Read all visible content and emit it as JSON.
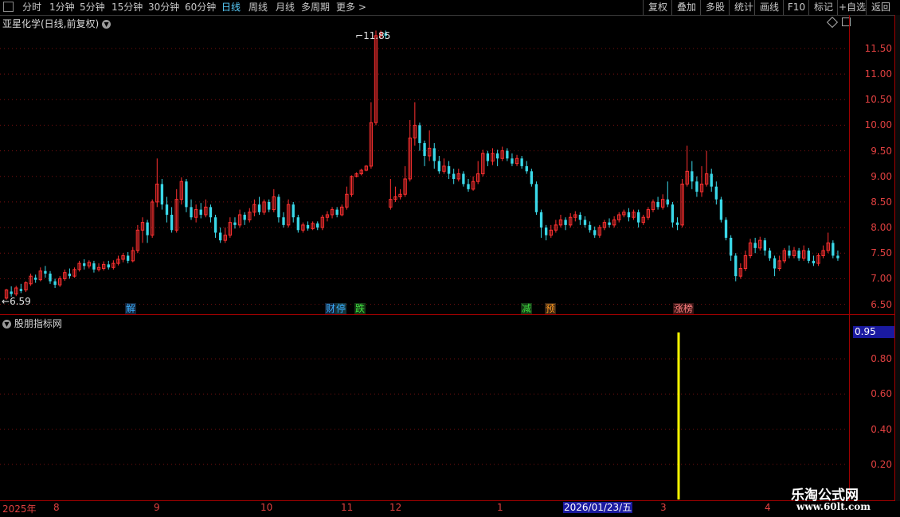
{
  "toolbar": {
    "periods": [
      "分时",
      "1分钟",
      "5分钟",
      "15分钟",
      "30分钟",
      "60分钟",
      "日线",
      "周线",
      "月线",
      "多周期",
      "更多 >"
    ],
    "active_period": "日线",
    "right_buttons": [
      "复权",
      "叠加",
      "多股",
      "统计",
      "画线",
      "F10",
      "标记",
      "+自选",
      "返回"
    ]
  },
  "main_chart": {
    "title": "亚星化学(日线,前复权)",
    "high_label": "11.85",
    "low_label": "6.59",
    "y_ticks": [
      "11.50",
      "11.00",
      "10.50",
      "10.00",
      "9.50",
      "9.00",
      "8.50",
      "8.00",
      "7.50",
      "7.00",
      "6.50"
    ],
    "markers": [
      {
        "text": "解",
        "color": "#3ab0ff",
        "bg": "#1a1a3a"
      },
      {
        "text": "财",
        "color": "#3ab0ff",
        "bg": "#1a1a3a"
      },
      {
        "text": "停",
        "color": "#3ab0ff",
        "bg": "#1a3a3a"
      },
      {
        "text": "跌",
        "color": "#40e040",
        "bg": "#1a3a1a"
      },
      {
        "text": "减",
        "color": "#40e040",
        "bg": "#1a3a1a"
      },
      {
        "text": "预",
        "color": "#ff8c00",
        "bg": "#3a2a1a"
      },
      {
        "text": "涨榜",
        "color": "#ff8080",
        "bg": "#3a1a1a"
      }
    ],
    "colors": {
      "up": "#ff3030",
      "down": "#3ad8e8",
      "grid": "#7a1010",
      "axis": "#a00000"
    }
  },
  "indicator_panel": {
    "title": "股朋指标网",
    "value": "0.95",
    "y_ticks": [
      "0.80",
      "0.60",
      "0.40",
      "0.20"
    ],
    "bar_color": "#ffff00"
  },
  "x_axis": {
    "ticks": [
      "2025年",
      "8",
      "9",
      "10",
      "11",
      "12",
      "1",
      "3",
      "4"
    ],
    "cursor_date": "2026/01/23/五"
  },
  "watermark": {
    "line1": "乐淘公式网",
    "line2": "www.60lt.com"
  },
  "chart_data": {
    "type": "candlestick",
    "title": "亚星化学(日线,前复权)",
    "ylim": [
      6.4,
      11.95
    ],
    "candles": [
      [
        6.62,
        6.78,
        6.59,
        6.8
      ],
      [
        6.75,
        6.7,
        6.65,
        6.85
      ],
      [
        6.7,
        6.82,
        6.66,
        6.86
      ],
      [
        6.8,
        6.76,
        6.72,
        6.9
      ],
      [
        6.78,
        6.92,
        6.74,
        6.95
      ],
      [
        6.9,
        7.05,
        6.86,
        7.1
      ],
      [
        7.02,
        6.98,
        6.92,
        7.08
      ],
      [
        6.98,
        7.15,
        6.95,
        7.22
      ],
      [
        7.15,
        7.1,
        7.02,
        7.25
      ],
      [
        7.1,
        6.95,
        6.9,
        7.15
      ],
      [
        6.95,
        6.88,
        6.82,
        7.0
      ],
      [
        6.88,
        7.0,
        6.84,
        7.05
      ],
      [
        7.0,
        7.12,
        6.96,
        7.18
      ],
      [
        7.1,
        7.05,
        7.0,
        7.2
      ],
      [
        7.05,
        7.18,
        7.02,
        7.22
      ],
      [
        7.18,
        7.3,
        7.14,
        7.35
      ],
      [
        7.3,
        7.25,
        7.18,
        7.38
      ],
      [
        7.25,
        7.32,
        7.2,
        7.36
      ],
      [
        7.3,
        7.18,
        7.12,
        7.35
      ],
      [
        7.18,
        7.22,
        7.14,
        7.3
      ],
      [
        7.2,
        7.28,
        7.16,
        7.34
      ],
      [
        7.28,
        7.22,
        7.18,
        7.35
      ],
      [
        7.22,
        7.3,
        7.18,
        7.36
      ],
      [
        7.3,
        7.38,
        7.26,
        7.45
      ],
      [
        7.38,
        7.45,
        7.32,
        7.5
      ],
      [
        7.45,
        7.35,
        7.3,
        7.52
      ],
      [
        7.35,
        7.55,
        7.32,
        7.62
      ],
      [
        7.55,
        7.95,
        7.5,
        8.05
      ],
      [
        7.95,
        8.1,
        7.7,
        8.2
      ],
      [
        8.1,
        7.85,
        7.7,
        8.15
      ],
      [
        7.85,
        8.5,
        7.8,
        8.55
      ],
      [
        8.5,
        8.85,
        8.4,
        9.35
      ],
      [
        8.85,
        8.45,
        8.35,
        8.95
      ],
      [
        8.45,
        8.25,
        8.1,
        8.6
      ],
      [
        8.25,
        7.95,
        7.9,
        8.4
      ],
      [
        7.95,
        8.55,
        7.9,
        8.75
      ],
      [
        8.55,
        8.9,
        8.45,
        8.98
      ],
      [
        8.9,
        8.4,
        8.3,
        8.95
      ],
      [
        8.4,
        8.2,
        8.15,
        8.55
      ],
      [
        8.2,
        8.35,
        8.1,
        8.45
      ],
      [
        8.35,
        8.25,
        8.18,
        8.48
      ],
      [
        8.25,
        8.4,
        8.2,
        8.55
      ],
      [
        8.4,
        8.2,
        8.1,
        8.45
      ],
      [
        8.2,
        7.9,
        7.8,
        8.25
      ],
      [
        7.9,
        7.75,
        7.7,
        8.0
      ],
      [
        7.75,
        7.85,
        7.7,
        8.0
      ],
      [
        7.85,
        8.1,
        7.8,
        8.2
      ],
      [
        8.1,
        8.05,
        7.98,
        8.2
      ],
      [
        8.05,
        8.25,
        8.0,
        8.35
      ],
      [
        8.25,
        8.15,
        8.05,
        8.3
      ],
      [
        8.15,
        8.3,
        8.1,
        8.38
      ],
      [
        8.3,
        8.45,
        8.22,
        8.55
      ],
      [
        8.45,
        8.3,
        8.25,
        8.6
      ],
      [
        8.3,
        8.5,
        8.25,
        8.55
      ],
      [
        8.5,
        8.35,
        8.3,
        8.55
      ],
      [
        8.35,
        8.6,
        8.3,
        8.75
      ],
      [
        8.6,
        8.2,
        8.1,
        8.65
      ],
      [
        8.2,
        8.05,
        8.0,
        8.3
      ],
      [
        8.05,
        8.45,
        8.0,
        8.55
      ],
      [
        8.45,
        8.2,
        8.1,
        8.5
      ],
      [
        8.2,
        7.95,
        7.9,
        8.25
      ],
      [
        7.95,
        8.05,
        7.9,
        8.1
      ],
      [
        8.05,
        7.98,
        7.94,
        8.12
      ],
      [
        7.98,
        8.08,
        7.95,
        8.12
      ],
      [
        8.08,
        8.0,
        7.95,
        8.12
      ],
      [
        8.0,
        8.2,
        7.95,
        8.25
      ],
      [
        8.2,
        8.25,
        8.12,
        8.32
      ],
      [
        8.25,
        8.35,
        8.18,
        8.4
      ],
      [
        8.35,
        8.25,
        8.2,
        8.4
      ],
      [
        8.25,
        8.4,
        8.22,
        8.45
      ],
      [
        8.4,
        8.65,
        8.35,
        8.8
      ],
      [
        8.65,
        9.0,
        8.6,
        9.02
      ],
      [
        9.0,
        9.05,
        8.98,
        9.08
      ],
      [
        9.05,
        9.12,
        9.02,
        9.15
      ],
      [
        9.12,
        9.2,
        9.1,
        9.22
      ],
      [
        9.2,
        10.05,
        9.15,
        10.45
      ],
      [
        10.05,
        11.75,
        10.0,
        11.85
      ],
      [
        11.75,
        11.8,
        11.7,
        11.85
      ],
      [
        11.8,
        11.75,
        11.7,
        11.85
      ],
      [
        8.4,
        8.55,
        8.35,
        8.95
      ],
      [
        8.55,
        8.6,
        8.5,
        8.8
      ],
      [
        8.6,
        8.65,
        8.55,
        8.75
      ],
      [
        8.65,
        8.95,
        8.6,
        9.2
      ],
      [
        8.95,
        9.75,
        8.9,
        10.1
      ],
      [
        9.75,
        10.0,
        9.6,
        10.45
      ],
      [
        10.0,
        9.65,
        9.5,
        10.05
      ],
      [
        9.65,
        9.4,
        9.2,
        9.7
      ],
      [
        9.4,
        9.55,
        9.3,
        9.9
      ],
      [
        9.55,
        9.3,
        9.15,
        9.65
      ],
      [
        9.3,
        9.1,
        9.05,
        9.4
      ],
      [
        9.1,
        9.2,
        9.05,
        9.35
      ],
      [
        9.2,
        9.05,
        8.95,
        9.3
      ],
      [
        9.05,
        8.95,
        8.85,
        9.15
      ],
      [
        8.95,
        9.05,
        8.9,
        9.15
      ],
      [
        9.05,
        8.85,
        8.8,
        9.1
      ],
      [
        8.85,
        8.75,
        8.7,
        8.95
      ],
      [
        8.75,
        8.9,
        8.72,
        9.0
      ],
      [
        8.9,
        9.05,
        8.85,
        9.3
      ],
      [
        9.05,
        9.45,
        9.0,
        9.52
      ],
      [
        9.45,
        9.3,
        9.2,
        9.5
      ],
      [
        9.3,
        9.45,
        9.22,
        9.55
      ],
      [
        9.45,
        9.35,
        9.2,
        9.52
      ],
      [
        9.35,
        9.5,
        9.3,
        9.58
      ],
      [
        9.5,
        9.35,
        9.3,
        9.55
      ],
      [
        9.35,
        9.25,
        9.2,
        9.45
      ],
      [
        9.25,
        9.35,
        9.2,
        9.42
      ],
      [
        9.35,
        9.2,
        9.15,
        9.4
      ],
      [
        9.2,
        9.1,
        9.05,
        9.3
      ],
      [
        9.1,
        8.85,
        8.8,
        9.15
      ],
      [
        8.85,
        8.3,
        8.25,
        8.9
      ],
      [
        8.3,
        8.0,
        7.8,
        8.35
      ],
      [
        8.0,
        7.85,
        7.75,
        8.05
      ],
      [
        7.85,
        7.95,
        7.8,
        8.05
      ],
      [
        7.95,
        8.05,
        7.9,
        8.15
      ],
      [
        8.05,
        8.15,
        8.0,
        8.25
      ],
      [
        8.15,
        8.05,
        7.95,
        8.2
      ],
      [
        8.05,
        8.2,
        8.0,
        8.28
      ],
      [
        8.2,
        8.25,
        8.12,
        8.32
      ],
      [
        8.25,
        8.15,
        8.05,
        8.3
      ],
      [
        8.15,
        8.05,
        8.0,
        8.22
      ],
      [
        8.05,
        7.95,
        7.9,
        8.12
      ],
      [
        7.95,
        7.85,
        7.8,
        8.02
      ],
      [
        7.85,
        8.0,
        7.8,
        8.05
      ],
      [
        8.0,
        8.1,
        7.95,
        8.15
      ],
      [
        8.1,
        8.05,
        8.0,
        8.18
      ],
      [
        8.05,
        8.15,
        8.0,
        8.22
      ],
      [
        8.15,
        8.25,
        8.1,
        8.3
      ],
      [
        8.25,
        8.3,
        8.2,
        8.35
      ],
      [
        8.3,
        8.2,
        8.12,
        8.38
      ],
      [
        8.2,
        8.3,
        8.15,
        8.35
      ],
      [
        8.3,
        8.1,
        8.0,
        8.35
      ],
      [
        8.1,
        8.2,
        8.05,
        8.25
      ],
      [
        8.2,
        8.35,
        8.15,
        8.4
      ],
      [
        8.35,
        8.5,
        8.3,
        8.55
      ],
      [
        8.5,
        8.4,
        8.35,
        8.6
      ],
      [
        8.4,
        8.55,
        8.35,
        8.65
      ],
      [
        8.55,
        8.45,
        8.4,
        8.9
      ],
      [
        8.45,
        8.1,
        8.0,
        8.5
      ],
      [
        8.1,
        8.05,
        7.95,
        8.2
      ],
      [
        8.05,
        8.85,
        8.0,
        8.95
      ],
      [
        8.85,
        9.1,
        8.8,
        9.6
      ],
      [
        9.1,
        8.9,
        8.75,
        9.3
      ],
      [
        8.9,
        8.7,
        8.6,
        9.0
      ],
      [
        8.7,
        8.85,
        8.6,
        9.2
      ],
      [
        8.85,
        9.05,
        8.8,
        9.5
      ],
      [
        9.05,
        8.8,
        8.7,
        9.15
      ],
      [
        8.8,
        8.55,
        8.45,
        8.9
      ],
      [
        8.55,
        8.15,
        8.1,
        8.6
      ],
      [
        8.15,
        7.8,
        7.75,
        8.2
      ],
      [
        7.8,
        7.45,
        7.35,
        7.85
      ],
      [
        7.45,
        7.05,
        6.95,
        7.5
      ],
      [
        7.05,
        7.2,
        7.0,
        7.3
      ],
      [
        7.2,
        7.45,
        7.15,
        7.55
      ],
      [
        7.45,
        7.7,
        7.4,
        7.78
      ],
      [
        7.7,
        7.6,
        7.5,
        7.8
      ],
      [
        7.6,
        7.75,
        7.55,
        7.82
      ],
      [
        7.75,
        7.55,
        7.45,
        7.8
      ],
      [
        7.55,
        7.4,
        7.35,
        7.6
      ],
      [
        7.4,
        7.2,
        7.05,
        7.45
      ],
      [
        7.2,
        7.35,
        7.15,
        7.45
      ],
      [
        7.35,
        7.55,
        7.3,
        7.6
      ],
      [
        7.55,
        7.45,
        7.4,
        7.65
      ],
      [
        7.45,
        7.55,
        7.4,
        7.62
      ],
      [
        7.55,
        7.4,
        7.35,
        7.6
      ],
      [
        7.4,
        7.55,
        7.35,
        7.65
      ],
      [
        7.55,
        7.35,
        7.3,
        7.6
      ],
      [
        7.35,
        7.3,
        7.25,
        7.45
      ],
      [
        7.3,
        7.45,
        7.25,
        7.5
      ],
      [
        7.45,
        7.55,
        7.4,
        7.65
      ],
      [
        7.55,
        7.7,
        7.5,
        7.9
      ],
      [
        7.7,
        7.45,
        7.4,
        7.75
      ],
      [
        7.45,
        7.4,
        7.35,
        7.55
      ]
    ],
    "indicator_values": [
      {
        "index": 155,
        "value": 0.95
      }
    ]
  }
}
